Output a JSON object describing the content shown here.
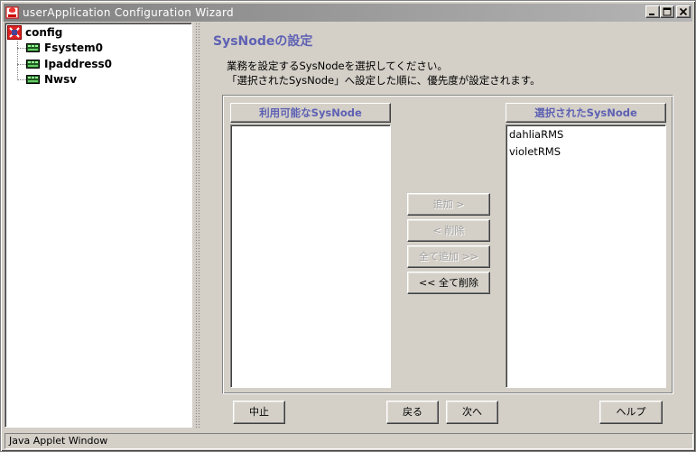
{
  "window": {
    "title": "userApplication Configuration Wizard",
    "status": "Java Applet Window"
  },
  "tree": {
    "root": {
      "label": "config",
      "icon": "config-icon"
    },
    "children": [
      {
        "label": "Fsystem0",
        "icon": "resource-icon"
      },
      {
        "label": "Ipaddress0",
        "icon": "resource-icon"
      },
      {
        "label": "Nwsv",
        "icon": "resource-icon"
      }
    ]
  },
  "page": {
    "title": "SysNodeの設定",
    "description_line1": "業務を設定するSysNodeを選択してください。",
    "description_line2": "「選択されたSysNode」へ設定した順に、優先度が設定されます。"
  },
  "available": {
    "header": "利用可能なSysNode",
    "items": []
  },
  "selected": {
    "header": "選択されたSysNode",
    "items": [
      "dahliaRMS",
      "violetRMS"
    ]
  },
  "actions": {
    "add": "追加 >",
    "remove": "< 削除",
    "add_all": "全て追加 >>",
    "remove_all": "<< 全て削除"
  },
  "footer": {
    "cancel": "中止",
    "back": "戻る",
    "next": "次へ",
    "help": "ヘルプ"
  },
  "colors": {
    "heading": "#5e61b3",
    "face": "#d4d0c8"
  }
}
